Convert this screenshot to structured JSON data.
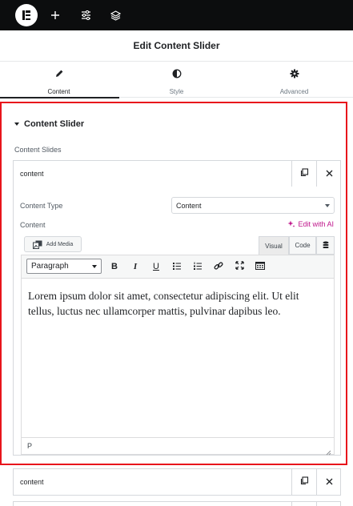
{
  "topbar": {
    "icons": [
      "elementor-logo-icon",
      "plus-icon",
      "sliders-icon",
      "layers-icon"
    ]
  },
  "panel": {
    "title": "Edit Content Slider"
  },
  "tabs": [
    {
      "label": "Content",
      "icon": "pencil-icon",
      "active": true
    },
    {
      "label": "Style",
      "icon": "half-circle-icon",
      "active": false
    },
    {
      "label": "Advanced",
      "icon": "gear-icon",
      "active": false
    }
  ],
  "section": {
    "title": "Content Slider",
    "repeater_label": "Content Slides",
    "highlight_color": "#e8141c",
    "items": [
      {
        "title": "content",
        "expanded": true
      },
      {
        "title": "content",
        "expanded": false
      }
    ]
  },
  "item_fields": {
    "content_type_label": "Content Type",
    "content_type_value": "Content",
    "content_label": "Content",
    "edit_ai_label": "Edit with AI",
    "ai_color": "#c0178c"
  },
  "editor": {
    "add_media_label": "Add Media",
    "visual_tab": "Visual",
    "code_tab": "Code",
    "format_value": "Paragraph",
    "toolbar_buttons": [
      "bold-icon",
      "italic-icon",
      "underline-icon",
      "bullet-list-icon",
      "numbered-list-icon",
      "link-icon",
      "fullscreen-icon",
      "toolbar-toggle-icon"
    ],
    "body_text": "Lorem ipsum dolor sit amet, consectetur adipiscing elit. Ut elit tellus, luctus nec ullamcorper mattis, pulvinar dapibus leo.",
    "status_path": "P"
  }
}
